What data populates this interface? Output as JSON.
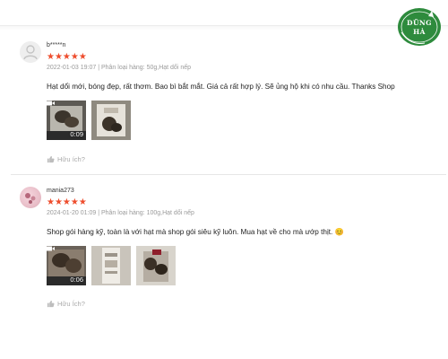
{
  "watermark": {
    "line1": "DŨNG",
    "line2": "HÀ"
  },
  "reviews": [
    {
      "username": "b*****n",
      "stars": "★★★★★",
      "meta": "2022-01-03 19:07 | Phân loại hàng: 50g,Hạt dổi nếp",
      "comment": "Hạt dổi mới, bóng đẹp, rất thơm. Bao bì bắt mắt. Giá cả rất hợp lý. Sẽ ủng hộ khi có nhu cầu. Thanks Shop",
      "video_duration": "0:09",
      "helpful_label": "Hữu ích?"
    },
    {
      "username": "mania273",
      "stars": "★★★★★",
      "meta": "2024-01-20 01:09 | Phân loại hàng: 100g,Hạt dổi nếp",
      "comment": "Shop gói hàng kỹ, toàn là với hạt mà shop gói siêu kỹ luôn. Mua hạt về cho mà ướp thịt. 😊",
      "video_duration": "0:06",
      "helpful_label": "Hữu Ích?"
    }
  ],
  "colors": {
    "star": "#ee4d2d",
    "watermark": "#2e8b3d"
  },
  "icons": [
    "user-avatar-placeholder-icon",
    "video-camera-icon",
    "thumbs-up-icon"
  ]
}
